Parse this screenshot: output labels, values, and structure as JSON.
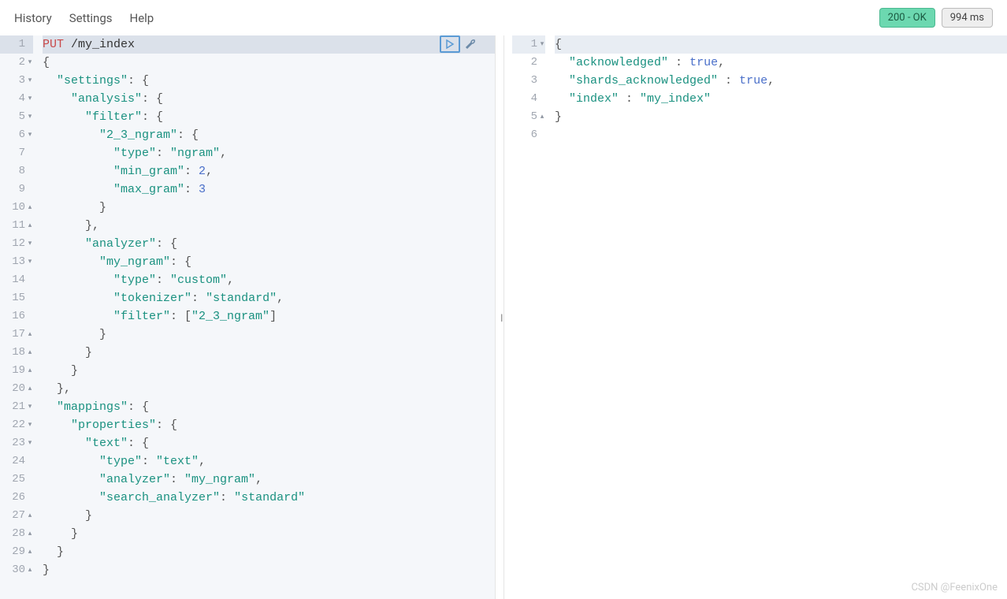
{
  "menu": {
    "history": "History",
    "settings": "Settings",
    "help": "Help"
  },
  "status": {
    "code": "200 - OK",
    "time": "994 ms"
  },
  "request": {
    "method": "PUT",
    "path": "/my_index",
    "lines": [
      {
        "n": 1,
        "fold": "",
        "tokens": [
          {
            "t": "PUT",
            "c": "kw-method"
          },
          {
            "t": " /my_index",
            "c": ""
          }
        ]
      },
      {
        "n": 2,
        "fold": "▾",
        "tokens": [
          {
            "t": "{",
            "c": "punct"
          }
        ]
      },
      {
        "n": 3,
        "fold": "▾",
        "tokens": [
          {
            "t": "  ",
            "c": ""
          },
          {
            "t": "\"settings\"",
            "c": "str"
          },
          {
            "t": ": {",
            "c": "punct"
          }
        ]
      },
      {
        "n": 4,
        "fold": "▾",
        "tokens": [
          {
            "t": "    ",
            "c": ""
          },
          {
            "t": "\"analysis\"",
            "c": "str"
          },
          {
            "t": ": {",
            "c": "punct"
          }
        ]
      },
      {
        "n": 5,
        "fold": "▾",
        "tokens": [
          {
            "t": "      ",
            "c": ""
          },
          {
            "t": "\"filter\"",
            "c": "str"
          },
          {
            "t": ": {",
            "c": "punct"
          }
        ]
      },
      {
        "n": 6,
        "fold": "▾",
        "tokens": [
          {
            "t": "        ",
            "c": ""
          },
          {
            "t": "\"2_3_ngram\"",
            "c": "str"
          },
          {
            "t": ": {",
            "c": "punct"
          }
        ]
      },
      {
        "n": 7,
        "fold": "",
        "tokens": [
          {
            "t": "          ",
            "c": ""
          },
          {
            "t": "\"type\"",
            "c": "str"
          },
          {
            "t": ": ",
            "c": "punct"
          },
          {
            "t": "\"ngram\"",
            "c": "str"
          },
          {
            "t": ",",
            "c": "punct"
          }
        ]
      },
      {
        "n": 8,
        "fold": "",
        "tokens": [
          {
            "t": "          ",
            "c": ""
          },
          {
            "t": "\"min_gram\"",
            "c": "str"
          },
          {
            "t": ": ",
            "c": "punct"
          },
          {
            "t": "2",
            "c": "num"
          },
          {
            "t": ",",
            "c": "punct"
          }
        ]
      },
      {
        "n": 9,
        "fold": "",
        "tokens": [
          {
            "t": "          ",
            "c": ""
          },
          {
            "t": "\"max_gram\"",
            "c": "str"
          },
          {
            "t": ": ",
            "c": "punct"
          },
          {
            "t": "3",
            "c": "num"
          }
        ]
      },
      {
        "n": 10,
        "fold": "▴",
        "tokens": [
          {
            "t": "        }",
            "c": "punct"
          }
        ]
      },
      {
        "n": 11,
        "fold": "▴",
        "tokens": [
          {
            "t": "      },",
            "c": "punct"
          }
        ]
      },
      {
        "n": 12,
        "fold": "▾",
        "tokens": [
          {
            "t": "      ",
            "c": ""
          },
          {
            "t": "\"analyzer\"",
            "c": "str"
          },
          {
            "t": ": {",
            "c": "punct"
          }
        ]
      },
      {
        "n": 13,
        "fold": "▾",
        "tokens": [
          {
            "t": "        ",
            "c": ""
          },
          {
            "t": "\"my_ngram\"",
            "c": "str"
          },
          {
            "t": ": {",
            "c": "punct"
          }
        ]
      },
      {
        "n": 14,
        "fold": "",
        "tokens": [
          {
            "t": "          ",
            "c": ""
          },
          {
            "t": "\"type\"",
            "c": "str"
          },
          {
            "t": ": ",
            "c": "punct"
          },
          {
            "t": "\"custom\"",
            "c": "str"
          },
          {
            "t": ",",
            "c": "punct"
          }
        ]
      },
      {
        "n": 15,
        "fold": "",
        "tokens": [
          {
            "t": "          ",
            "c": ""
          },
          {
            "t": "\"tokenizer\"",
            "c": "str"
          },
          {
            "t": ": ",
            "c": "punct"
          },
          {
            "t": "\"standard\"",
            "c": "str"
          },
          {
            "t": ",",
            "c": "punct"
          }
        ]
      },
      {
        "n": 16,
        "fold": "",
        "tokens": [
          {
            "t": "          ",
            "c": ""
          },
          {
            "t": "\"filter\"",
            "c": "str"
          },
          {
            "t": ": [",
            "c": "punct"
          },
          {
            "t": "\"2_3_ngram\"",
            "c": "str"
          },
          {
            "t": "]",
            "c": "punct"
          }
        ]
      },
      {
        "n": 17,
        "fold": "▴",
        "tokens": [
          {
            "t": "        }",
            "c": "punct"
          }
        ]
      },
      {
        "n": 18,
        "fold": "▴",
        "tokens": [
          {
            "t": "      }",
            "c": "punct"
          }
        ]
      },
      {
        "n": 19,
        "fold": "▴",
        "tokens": [
          {
            "t": "    }",
            "c": "punct"
          }
        ]
      },
      {
        "n": 20,
        "fold": "▴",
        "tokens": [
          {
            "t": "  },",
            "c": "punct"
          }
        ]
      },
      {
        "n": 21,
        "fold": "▾",
        "tokens": [
          {
            "t": "  ",
            "c": ""
          },
          {
            "t": "\"mappings\"",
            "c": "str"
          },
          {
            "t": ": {",
            "c": "punct"
          }
        ]
      },
      {
        "n": 22,
        "fold": "▾",
        "tokens": [
          {
            "t": "    ",
            "c": ""
          },
          {
            "t": "\"properties\"",
            "c": "str"
          },
          {
            "t": ": {",
            "c": "punct"
          }
        ]
      },
      {
        "n": 23,
        "fold": "▾",
        "tokens": [
          {
            "t": "      ",
            "c": ""
          },
          {
            "t": "\"text\"",
            "c": "str"
          },
          {
            "t": ": {",
            "c": "punct"
          }
        ]
      },
      {
        "n": 24,
        "fold": "",
        "tokens": [
          {
            "t": "        ",
            "c": ""
          },
          {
            "t": "\"type\"",
            "c": "str"
          },
          {
            "t": ": ",
            "c": "punct"
          },
          {
            "t": "\"text\"",
            "c": "str"
          },
          {
            "t": ",",
            "c": "punct"
          }
        ]
      },
      {
        "n": 25,
        "fold": "",
        "tokens": [
          {
            "t": "        ",
            "c": ""
          },
          {
            "t": "\"analyzer\"",
            "c": "str"
          },
          {
            "t": ": ",
            "c": "punct"
          },
          {
            "t": "\"my_ngram\"",
            "c": "str"
          },
          {
            "t": ",",
            "c": "punct"
          }
        ]
      },
      {
        "n": 26,
        "fold": "",
        "tokens": [
          {
            "t": "        ",
            "c": ""
          },
          {
            "t": "\"search_analyzer\"",
            "c": "str"
          },
          {
            "t": ": ",
            "c": "punct"
          },
          {
            "t": "\"standard\"",
            "c": "str"
          }
        ]
      },
      {
        "n": 27,
        "fold": "▴",
        "tokens": [
          {
            "t": "      }",
            "c": "punct"
          }
        ]
      },
      {
        "n": 28,
        "fold": "▴",
        "tokens": [
          {
            "t": "    }",
            "c": "punct"
          }
        ]
      },
      {
        "n": 29,
        "fold": "▴",
        "tokens": [
          {
            "t": "  }",
            "c": "punct"
          }
        ]
      },
      {
        "n": 30,
        "fold": "▴",
        "tokens": [
          {
            "t": "}",
            "c": "punct"
          }
        ]
      }
    ]
  },
  "response": {
    "lines": [
      {
        "n": 1,
        "fold": "▾",
        "tokens": [
          {
            "t": "{",
            "c": "punct"
          }
        ]
      },
      {
        "n": 2,
        "fold": "",
        "tokens": [
          {
            "t": "  ",
            "c": ""
          },
          {
            "t": "\"acknowledged\"",
            "c": "str"
          },
          {
            "t": " : ",
            "c": "punct"
          },
          {
            "t": "true",
            "c": "bool"
          },
          {
            "t": ",",
            "c": "punct"
          }
        ]
      },
      {
        "n": 3,
        "fold": "",
        "tokens": [
          {
            "t": "  ",
            "c": ""
          },
          {
            "t": "\"shards_acknowledged\"",
            "c": "str"
          },
          {
            "t": " : ",
            "c": "punct"
          },
          {
            "t": "true",
            "c": "bool"
          },
          {
            "t": ",",
            "c": "punct"
          }
        ]
      },
      {
        "n": 4,
        "fold": "",
        "tokens": [
          {
            "t": "  ",
            "c": ""
          },
          {
            "t": "\"index\"",
            "c": "str"
          },
          {
            "t": " : ",
            "c": "punct"
          },
          {
            "t": "\"my_index\"",
            "c": "str"
          }
        ]
      },
      {
        "n": 5,
        "fold": "▴",
        "tokens": [
          {
            "t": "}",
            "c": "punct"
          }
        ]
      },
      {
        "n": 6,
        "fold": "",
        "tokens": [
          {
            "t": "",
            "c": ""
          }
        ]
      }
    ]
  },
  "watermark": "CSDN @FeenixOne"
}
